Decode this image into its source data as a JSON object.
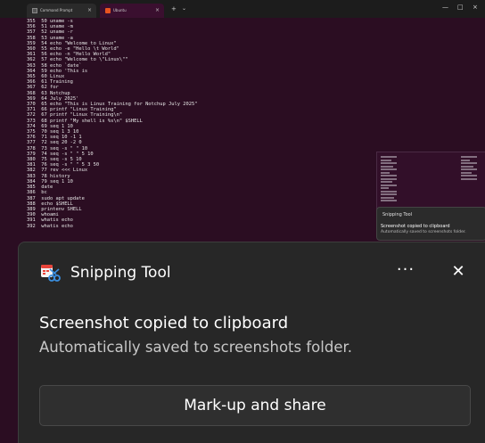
{
  "window": {
    "tabs": [
      {
        "label": "Command Prompt",
        "close": "×"
      },
      {
        "label": "Ubuntu",
        "close": "×"
      }
    ],
    "new_tab": "+",
    "dropdown": "⌄",
    "controls": [
      "—",
      "□",
      "×"
    ]
  },
  "terminal": {
    "lines": [
      "355  50 uname -s",
      "356  51 uname -m",
      "357  52 uname -r",
      "358  53 uname -a",
      "359  54 echo \"Welcome to Linux\"",
      "360  55 echo -e \"Hello \\t World\"",
      "361  56 echo -n \"Hello World\"",
      "362  57 echo \"Welcome to \\\"Linux\\\"\"",
      "363  58 echo `date`",
      "364  59 echo 'This is",
      "365  60 Linux",
      "366  61 Training",
      "367  62 for",
      "368  63 Notchup",
      "369  64 July 2025'",
      "370  65 echo \"This is Linux Training for Notchup July 2025\"",
      "371  66 printf \"Linux Training\"",
      "372  67 printf \"Linux Training\\n\"",
      "373  68 printf \"My shell is %s\\n\" $SHELL",
      "374  69 seq 1 10",
      "375  70 seq 1 3 10",
      "376  71 seq 10 -1 1",
      "377  72 seq 20 -2 0",
      "378  73 seq -s \" \" 10",
      "379  74 seq -s \" \" 5 10",
      "380  75 seq -s 5 10",
      "381  76 seq -s \" \" 5 3 50",
      "382  77 rev <<< Linux",
      "383  78 history",
      "384  79 seq 1 10",
      "385  date",
      "386  bc",
      "387  sudo apt update",
      "388  echo $SHELL",
      "389  printenv SHELL",
      "390  whoami",
      "391  whatis echo",
      "392  whatis echo"
    ]
  },
  "mini_toast": {
    "app": "Snipping Tool",
    "title": "Screenshot copied to clipboard",
    "subtitle": "Automatically saved to screenshots folder."
  },
  "toast": {
    "app_name": "Snipping Tool",
    "more_label": "···",
    "close_label": "✕",
    "title": "Screenshot copied to clipboard",
    "subtitle": "Automatically saved to screenshots folder.",
    "action_label": "Mark-up and share"
  },
  "colors": {
    "terminal_bg": "#2b0d22",
    "toast_bg": "#272727",
    "button_bg": "#2f2f2f"
  }
}
